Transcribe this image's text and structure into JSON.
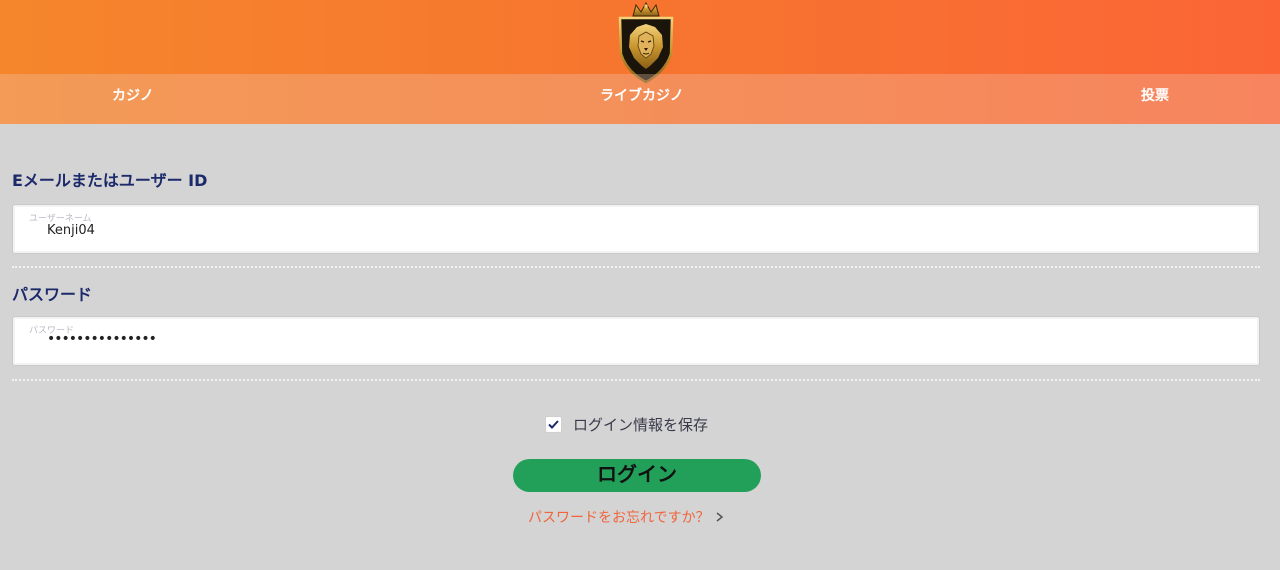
{
  "header": {
    "logo_icon": "lion-crown-shield-icon",
    "colors": {
      "gradient_start": "#f5862c",
      "gradient_end": "#fb6536"
    }
  },
  "nav": {
    "items": [
      {
        "label": "カジノ"
      },
      {
        "label": "ライブカジノ"
      },
      {
        "label": "投票"
      }
    ]
  },
  "form": {
    "username": {
      "label": "Eメールまたはユーザー ID",
      "placeholder": "ユーザーネーム",
      "value": "Kenji04"
    },
    "password": {
      "label": "パスワード",
      "placeholder": "パスワード",
      "value": "•••••••••••••••"
    },
    "remember": {
      "label": "ログイン情報を保存",
      "checked": true
    },
    "login_button": "ログイン",
    "forgot_link": "パスワードをお忘れですか？"
  },
  "colors": {
    "background": "#d4d4d4",
    "label_text": "#1c2a6b",
    "login_button": "#22a05a",
    "link": "#f0653c"
  }
}
